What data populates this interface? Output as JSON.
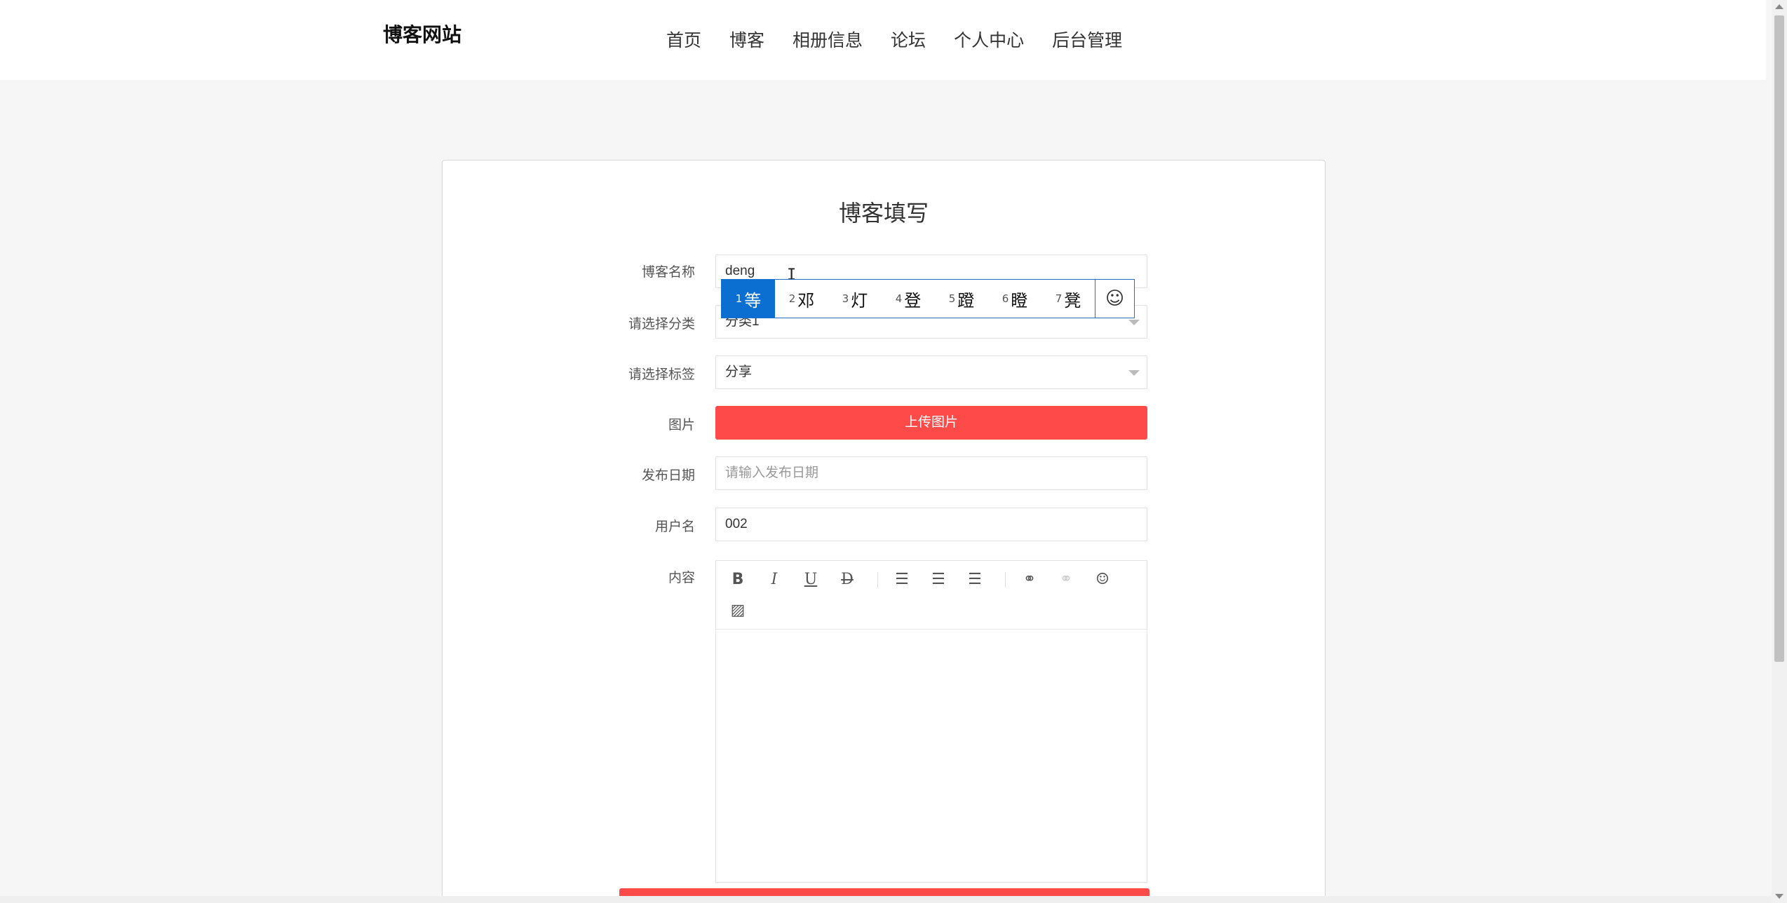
{
  "header": {
    "logo": "博客网站",
    "nav": [
      "首页",
      "博客",
      "相册信息",
      "论坛",
      "个人中心",
      "后台管理"
    ]
  },
  "form": {
    "title": "博客填写",
    "blog_name": {
      "label": "博客名称",
      "value": "deng"
    },
    "category": {
      "label": "请选择分类",
      "value": "分类1"
    },
    "tag": {
      "label": "请选择标签",
      "value": "分享"
    },
    "image": {
      "label": "图片",
      "button": "上传图片"
    },
    "publish_date": {
      "label": "发布日期",
      "placeholder": "请输入发布日期"
    },
    "username": {
      "label": "用户名",
      "value": "002"
    },
    "content": {
      "label": "内容"
    }
  },
  "editor_toolbar": [
    "bold-icon",
    "italic-icon",
    "underline-icon",
    "strikethrough-icon",
    "align-left-icon",
    "align-center-icon",
    "align-right-icon",
    "link-icon",
    "unlink-icon",
    "emoji-icon",
    "image-icon"
  ],
  "ime": {
    "candidates": [
      {
        "num": "1",
        "char": "等"
      },
      {
        "num": "2",
        "char": "邓"
      },
      {
        "num": "3",
        "char": "灯"
      },
      {
        "num": "4",
        "char": "登"
      },
      {
        "num": "5",
        "char": "蹬"
      },
      {
        "num": "6",
        "char": "瞪"
      },
      {
        "num": "7",
        "char": "凳"
      }
    ],
    "selected_index": 0
  },
  "colors": {
    "accent": "#ff4a4a",
    "ime_highlight": "#0a6fd1"
  }
}
